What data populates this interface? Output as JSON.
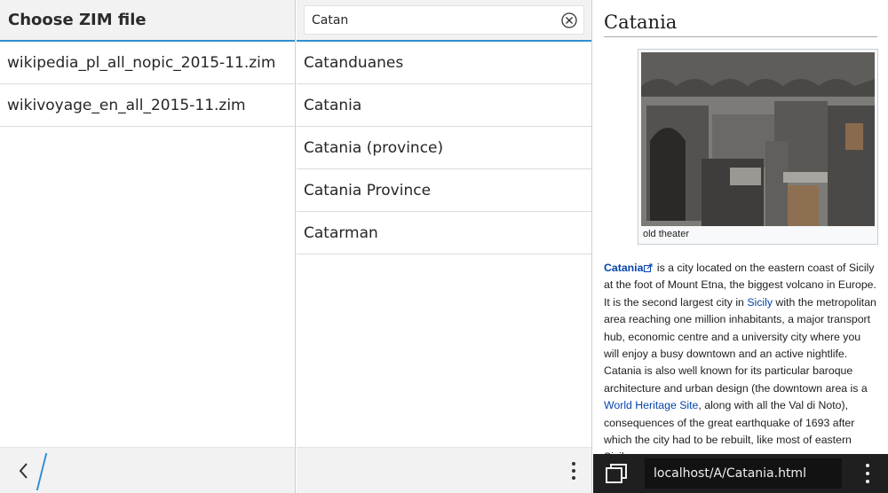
{
  "files_pane": {
    "title": "Choose ZIM file",
    "files": [
      {
        "label": "wikipedia_pl_all_nopic_2015-11.zim"
      },
      {
        "label": "wikivoyage_en_all_2015-11.zim"
      }
    ],
    "back_icon": "chevron-left-icon"
  },
  "search_pane": {
    "query": "Catan",
    "clear_icon": "clear-circle-x-icon",
    "results": [
      {
        "label": "Catanduanes"
      },
      {
        "label": "Catania"
      },
      {
        "label": "Catania (province)"
      },
      {
        "label": "Catania Province"
      },
      {
        "label": "Catarman"
      }
    ],
    "overflow_icon": "vertical-ellipsis-icon"
  },
  "article": {
    "title": "Catania",
    "image_caption": "old theater",
    "body": {
      "lead_link": "Catania",
      "text1": " is a city located on the eastern coast of Sicily at the foot of Mount Etna, the biggest volcano in Europe. It is the second largest city in ",
      "link_sicily": "Sicily",
      "text2": " with the metropolitan area reaching one million inhabitants, a major transport hub, economic centre and a university city where you will enjoy a busy downtown and an active nightlife. Catania is also well known for its particular baroque architecture and urban design (the downtown area is a ",
      "link_whs": "World Heritage Site",
      "text3": ", along with all the Val di Noto), consequences of the great earthquake of 1693 after which the city had to be rebuilt, like most of eastern Sicily."
    }
  },
  "browser": {
    "url": "localhost/A/Catania.html",
    "tabs_icon": "tabs-icon",
    "menu_icon": "vertical-ellipsis-icon"
  },
  "colors": {
    "accent": "#2f8fd1",
    "link": "#0645ad",
    "browser_bar": "#1f1f1f"
  }
}
